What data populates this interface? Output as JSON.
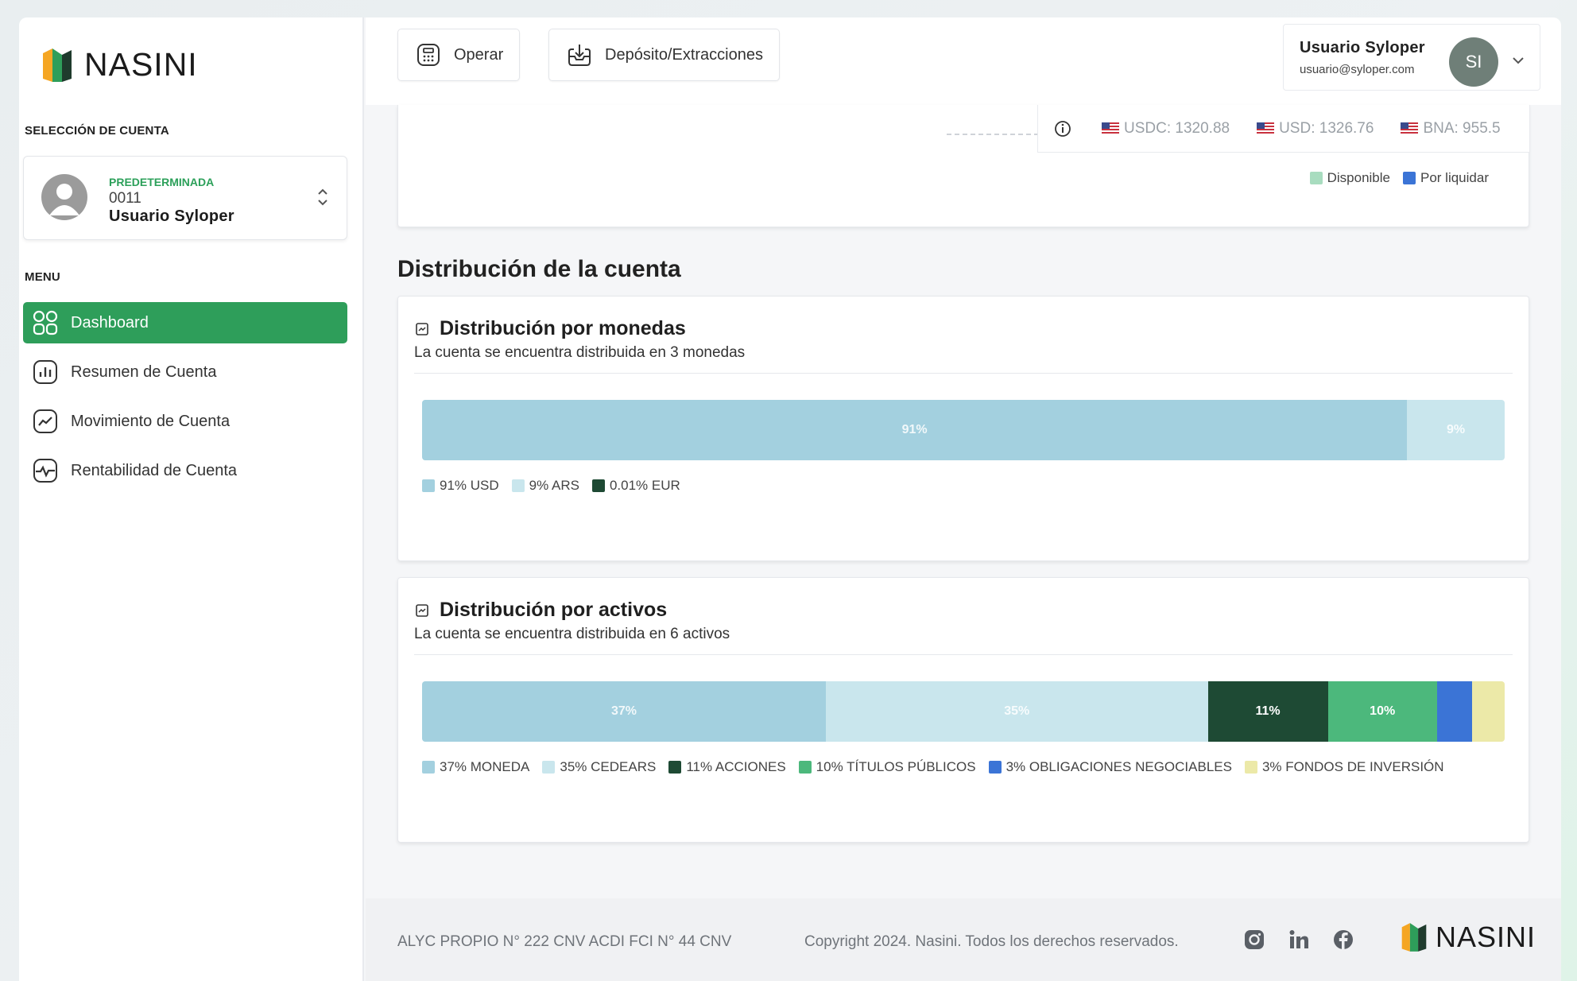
{
  "brand": {
    "name": "NASINI",
    "colors": {
      "primary": "#2e9e5a",
      "orange": "#f5a623",
      "dark": "#1f3b2d"
    }
  },
  "sidebar": {
    "account_section_label": "SELECCIÓN DE CUENTA",
    "account": {
      "tag": "PREDETERMINADA",
      "number": "0011",
      "name": "Usuario Syloper"
    },
    "menu_label": "MENU",
    "items": [
      {
        "label": "Dashboard",
        "icon": "grid-icon",
        "active": true
      },
      {
        "label": "Resumen de Cuenta",
        "icon": "bar-chart-icon",
        "active": false
      },
      {
        "label": "Movimiento de Cuenta",
        "icon": "trend-icon",
        "active": false
      },
      {
        "label": "Rentabilidad de Cuenta",
        "icon": "pulse-icon",
        "active": false
      }
    ]
  },
  "topbar": {
    "operar_label": "Operar",
    "deposito_label": "Depósito/Extracciones",
    "user": {
      "name": "Usuario Syloper",
      "email": "usuario@syloper.com",
      "initials": "SI"
    }
  },
  "rates": [
    {
      "label": "USDC: 1320.88"
    },
    {
      "label": "USD: 1326.76"
    },
    {
      "label": "BNA: 955.5"
    }
  ],
  "top_legend": [
    {
      "label": "Disponible",
      "color": "#a8dcbf"
    },
    {
      "label": "Por liquidar",
      "color": "#3b74d6"
    }
  ],
  "section_title": "Distribución de la cuenta",
  "chart_data": [
    {
      "type": "bar",
      "title": "Distribución por monedas",
      "subtitle": "La cuenta se encuentra distribuida en 3 monedas",
      "stacked": true,
      "orientation": "horizontal",
      "series": [
        {
          "name": "USD",
          "value": 91,
          "bar_label": "91%",
          "legend": "91% USD",
          "color": "#a3d0df"
        },
        {
          "name": "ARS",
          "value": 9,
          "bar_label": "9%",
          "legend": "9% ARS",
          "color": "#c9e6ed"
        },
        {
          "name": "EUR",
          "value": 0.01,
          "bar_label": "",
          "legend": "0.01% EUR",
          "color": "#1e4a34"
        }
      ]
    },
    {
      "type": "bar",
      "title": "Distribución por activos",
      "subtitle": "La cuenta se encuentra distribuida en 6 activos",
      "stacked": true,
      "orientation": "horizontal",
      "series": [
        {
          "name": "MONEDA",
          "value": 37,
          "bar_label": "37%",
          "legend": "37% MONEDA",
          "color": "#a3d0df",
          "dark": false
        },
        {
          "name": "CEDEARS",
          "value": 35,
          "bar_label": "35%",
          "legend": "35% CEDEARS",
          "color": "#c9e6ed",
          "dark": false
        },
        {
          "name": "ACCIONES",
          "value": 11,
          "bar_label": "11%",
          "legend": "11% ACCIONES",
          "color": "#1e4a34",
          "dark": true
        },
        {
          "name": "TÍTULOS PÚBLICOS",
          "value": 10,
          "bar_label": "10%",
          "legend": "10% TÍTULOS PÚBLICOS",
          "color": "#4cb87c",
          "dark": true
        },
        {
          "name": "OBLIGACIONES NEGOCIABLES",
          "value": 3.2,
          "bar_label": "",
          "legend": "3% OBLIGACIONES NEGOCIABLES",
          "color": "#3b74d6",
          "dark": true
        },
        {
          "name": "FONDOS DE INVERSIÓN",
          "value": 3.0,
          "bar_label": "",
          "legend": "3% FONDOS DE INVERSIÓN",
          "color": "#ece9a8",
          "dark": false
        }
      ]
    }
  ],
  "footer": {
    "left": "ALYC PROPIO N° 222 CNV ACDI FCI N° 44 CNV",
    "copyright": "Copyright 2024. Nasini. Todos los derechos reservados.",
    "socials": [
      "instagram-icon",
      "linkedin-icon",
      "facebook-icon"
    ]
  }
}
